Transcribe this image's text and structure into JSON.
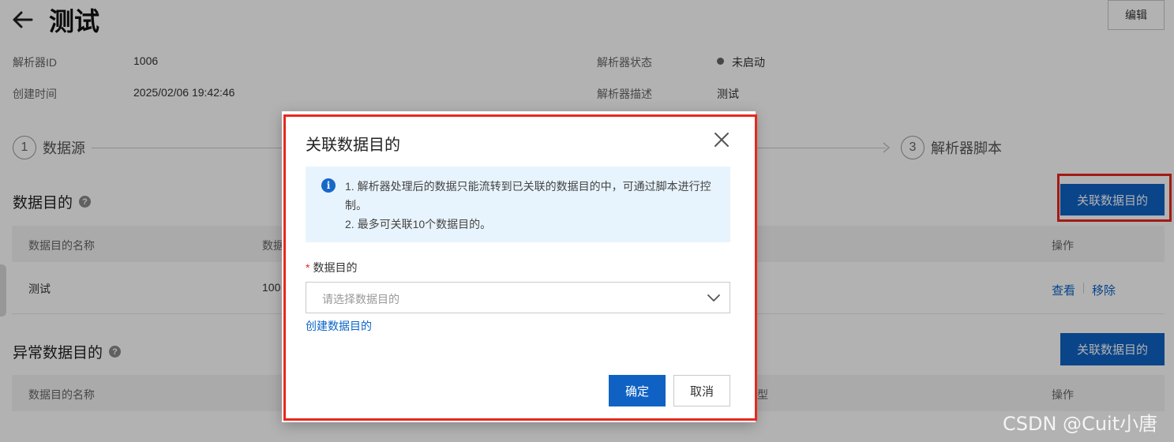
{
  "header": {
    "title": "测试",
    "edit_label": "编辑"
  },
  "info": {
    "parser_id_label": "解析器ID",
    "parser_id_value": "1006",
    "created_label": "创建时间",
    "created_value": "2025/02/06 19:42:46",
    "status_label": "解析器状态",
    "status_value": "未启动",
    "desc_label": "解析器描述",
    "desc_value": "测试"
  },
  "steps": [
    {
      "num": "1",
      "label": "数据源"
    },
    {
      "num": "3",
      "label": "解析器脚本"
    }
  ],
  "destinations": {
    "title": "数据目的",
    "add_label": "关联数据目的",
    "columns": {
      "name": "数据目的名称",
      "second_partial": "数据",
      "ops": "操作"
    },
    "rows": [
      {
        "name": "测试",
        "second_partial": "100",
        "view": "查看",
        "remove": "移除"
      }
    ]
  },
  "error_destinations": {
    "title": "异常数据目的",
    "add_label": "关联数据目的",
    "columns": {
      "name": "数据目的名称",
      "type_partial": "型",
      "ops": "操作"
    }
  },
  "dialog": {
    "title": "关联数据目的",
    "notice_line1": "1. 解析器处理后的数据只能流转到已关联的数据目的中，可通过脚本进行控制。",
    "notice_line2": "2. 最多可关联10个数据目的。",
    "field_label": "数据目的",
    "required_mark": "*",
    "select_placeholder": "请选择数据目的",
    "create_link": "创建数据目的",
    "ok_label": "确定",
    "cancel_label": "取消"
  },
  "watermark": "CSDN @Cuit小唐",
  "colors": {
    "primary": "#0f62c4",
    "highlight": "#e8281e",
    "notice_bg": "#e8f4fd",
    "link": "#0a64c8"
  }
}
